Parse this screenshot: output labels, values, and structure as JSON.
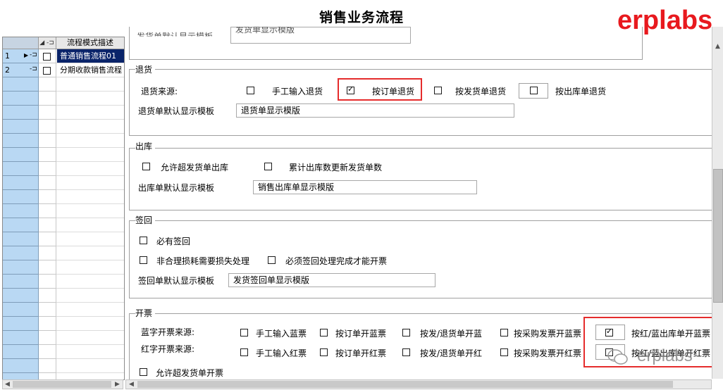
{
  "window": {
    "title": "销售业务流程",
    "brand": "erplabs"
  },
  "grid": {
    "header_desc": "流程模式描述",
    "rows": [
      {
        "num": "1",
        "desc": "普通销售流程01",
        "selected": true
      },
      {
        "num": "2",
        "desc": "分期收款销售流程",
        "selected": false
      }
    ]
  },
  "top_partial": {
    "label": "发货单默认显示模板",
    "value": "发货单显示模版"
  },
  "return_section": {
    "title": "退货",
    "source_label": "退货来源:",
    "options": [
      {
        "label": "手工输入退货",
        "checked": false
      },
      {
        "label": "按订单退货",
        "checked": true
      },
      {
        "label": "按发货单退货",
        "checked": false
      },
      {
        "label": "按出库单退货",
        "checked": false
      }
    ],
    "template_label": "退货单默认显示模板",
    "template_value": "退货单显示模版"
  },
  "outbound_section": {
    "title": "出库",
    "options": [
      {
        "label": "允许超发货单出库",
        "checked": false
      },
      {
        "label": "累计出库数更新发货单数",
        "checked": false
      }
    ],
    "template_label": "出库单默认显示模板",
    "template_value": "销售出库单显示模版"
  },
  "signoff_section": {
    "title": "签回",
    "options": [
      {
        "label": "必有签回",
        "checked": false
      },
      {
        "label": "非合理损耗需要损失处理",
        "checked": false
      },
      {
        "label": "必须签回处理完成才能开票",
        "checked": false
      }
    ],
    "template_label": "签回单默认显示模板",
    "template_value": "发货签回单显示模版"
  },
  "invoice_section": {
    "title": "开票",
    "blue_label": "蓝字开票来源:",
    "red_label": "红字开票来源:",
    "blue_options": [
      {
        "label": "手工输入蓝票",
        "checked": false
      },
      {
        "label": "按订单开蓝票",
        "checked": false
      },
      {
        "label": "按发/退货单开蓝",
        "checked": false
      },
      {
        "label": "按采购发票开蓝票",
        "checked": false
      },
      {
        "label": "按红/蓝出库单开蓝票",
        "checked": true
      }
    ],
    "red_options": [
      {
        "label": "手工输入红票",
        "checked": false
      },
      {
        "label": "按订单开红票",
        "checked": false
      },
      {
        "label": "按发/退货单开红",
        "checked": false
      },
      {
        "label": "按采购发票开红票",
        "checked": false
      },
      {
        "label": "按红/蓝出库单开红票",
        "checked": false
      }
    ],
    "allow_label": "允许超发货单开票",
    "watermark": "erplabs"
  },
  "colors": {
    "selection": "#0a246a",
    "rownum_bg": "#b9d8f3",
    "highlight": "#e52c2c",
    "brand": "#e8191e"
  }
}
